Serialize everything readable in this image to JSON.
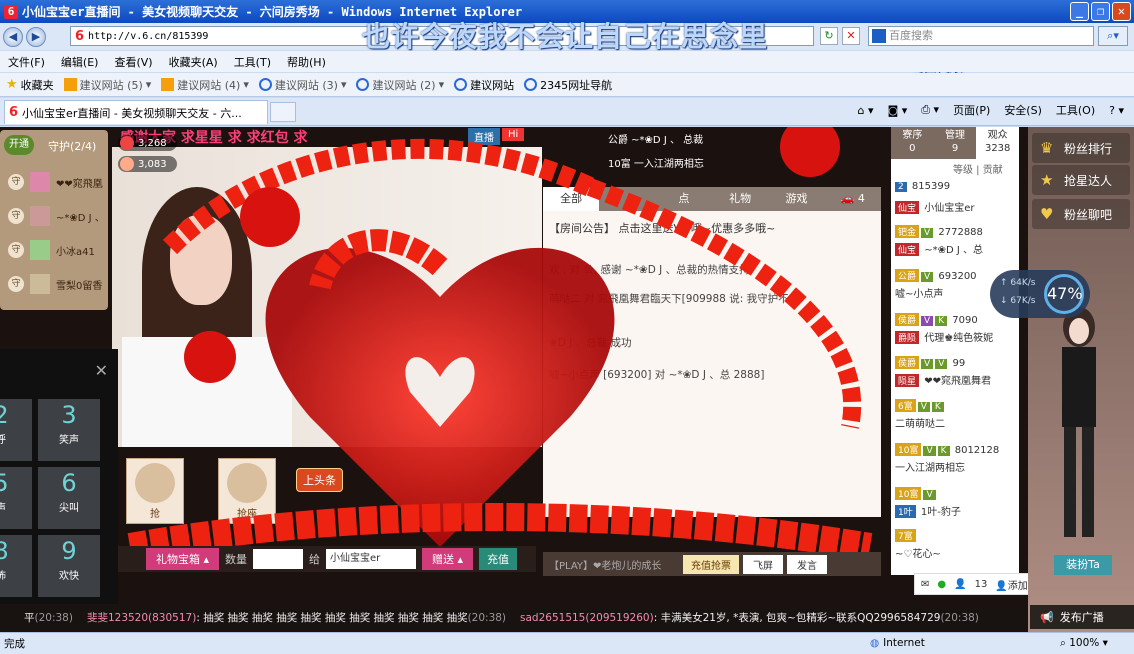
{
  "window": {
    "title": "小仙宝宝er直播间 - 美女视频聊天交友 - 六间房秀场 - Windows Internet Explorer",
    "url": "http://v.6.cn/815399",
    "search_placeholder": "百度搜索"
  },
  "overlay_lyrics": {
    "line1": "也许今夜我不会让自己在思念里",
    "line2": "沉沦"
  },
  "menu": [
    "文件(F)",
    "编辑(E)",
    "查看(V)",
    "收藏夹(A)",
    "工具(T)",
    "帮助(H)"
  ],
  "favorites": {
    "label": "收藏夹",
    "items": [
      "建议网站 (5)",
      "建议网站 (4)",
      "建议网站 (3)",
      "建议网站 (2)",
      "建议网站",
      "2345网址导航"
    ]
  },
  "tab": {
    "title": "小仙宝宝er直播间 - 美女视频聊天交友 - 六..."
  },
  "commands": [
    "页面(P)",
    "安全(S)",
    "工具(O)"
  ],
  "room": {
    "title_banner": "感谢大家 求星星 求 求红包 求",
    "live_label": "直播",
    "hi_label": "Hi",
    "counter1": "3,268",
    "counter2": "3,083",
    "top_fan1": "公爵  ~*❀D J 、 总裁",
    "top_fan2": "10富  一入江湖两相忘"
  },
  "guard": {
    "open_label": "开通",
    "title": "守护(2/4)",
    "members": [
      "❤❤窕飛凰",
      "~*❀D J 、",
      "小冰a41",
      "雪梨0留香"
    ]
  },
  "chat": {
    "tabs": [
      "全部",
      "",
      "点",
      "礼物",
      "游戏",
      ""
    ],
    "car_badge": "4",
    "announcement": "【房间公告】                    点击这里送VIP哦~优惠多多哦~",
    "lines": [
      "欢                , 对  公, 感谢 ~*❀D J 、总裁的热情支持!",
      "萌哒二 对         窕飛凰舞君臨天下[909988   说: 我守护不",
      "                ❀D J 、总裁 成功",
      "                  嘘~小点声 [693200] 对  ~*❀D J 、总    2888]"
    ]
  },
  "seats": {
    "seat1_label": "抢",
    "seat2_label": "抢座",
    "headline_label": "上头条"
  },
  "giftbar": {
    "gift_box": "礼物宝箱",
    "qty_label": "数量",
    "to_label": "给",
    "recipient": "小仙宝宝er",
    "send": "赠送",
    "recharge": "充值"
  },
  "inputbar": {
    "placeholder": "【PLAY】❤老炮儿的成长",
    "recharge_grab": "充值抢票",
    "fly_screen": "飞屏",
    "speak": "发言"
  },
  "side": {
    "tabs": [
      {
        "label": "寮序",
        "count": "0"
      },
      {
        "label": "管理",
        "count": "9"
      },
      {
        "label": "观众",
        "count": "3238"
      }
    ],
    "rank_labels": [
      "等级",
      "贡献"
    ],
    "users": [
      {
        "tags": [
          "2"
        ],
        "name": "815399"
      },
      {
        "tags": [
          "仙宝"
        ],
        "name": "小仙宝宝er"
      },
      {
        "tags": [
          "钯金",
          "V"
        ],
        "name": "2772888"
      },
      {
        "tags": [
          "仙宝"
        ],
        "name": "~*❀D J 、总"
      },
      {
        "tags": [
          "公爵",
          "V"
        ],
        "name": "693200"
      },
      {
        "tags": [],
        "name": "嘘~小点声"
      },
      {
        "tags": [
          "侯爵",
          "V",
          "K"
        ],
        "name": "7090"
      },
      {
        "tags": [
          "爵陨"
        ],
        "name": "代理♚纯色筱妮"
      },
      {
        "tags": [
          "侯爵",
          "V",
          "V"
        ],
        "name": "99"
      },
      {
        "tags": [
          "陨星"
        ],
        "name": "❤❤窕飛凰舞君"
      },
      {
        "tags": [
          "6富",
          "V",
          "K"
        ],
        "name": ""
      },
      {
        "tags": [],
        "name": "二萌萌哒二"
      },
      {
        "tags": [
          "10富",
          "V",
          "K"
        ],
        "name": "8012128"
      },
      {
        "tags": [],
        "name": "一入江湖两相忘"
      },
      {
        "tags": [
          "10富",
          "V"
        ],
        "name": ""
      },
      {
        "tags": [
          "1叶"
        ],
        "name": "1叶-豹子"
      },
      {
        "tags": [
          "7富"
        ],
        "name": ""
      },
      {
        "tags": [],
        "name": "~♡花心~"
      }
    ],
    "bottom_count": "13",
    "add_label": "添加"
  },
  "right_nav": {
    "items": [
      "粉丝排行",
      "抢星达人",
      "粉丝聊吧"
    ],
    "dress_label": "装扮Ta"
  },
  "net_widget": {
    "up": "64K/s",
    "down": "67K/s",
    "percent": "47%"
  },
  "keypad": {
    "keys": [
      {
        "n": "2",
        "t": "呼"
      },
      {
        "n": "3",
        "t": "笑声"
      },
      {
        "n": "5",
        "t": "声"
      },
      {
        "n": "6",
        "t": "尖叫"
      },
      {
        "n": "8",
        "t": "怖"
      },
      {
        "n": "9",
        "t": "欢快"
      }
    ]
  },
  "ticker": {
    "items": [
      {
        "name": "平",
        "time": "(20:38)",
        "text": ""
      },
      {
        "name": "斐斐123520(830517)",
        "text": ": 抽奖 抽奖 抽奖 抽奖 抽奖 抽奖 抽奖 抽奖 抽奖 抽奖 抽奖",
        "time": "(20:38)"
      },
      {
        "name": "sad2651515(209519260)",
        "text": ": 丰满美女21岁, *表演, 包爽~包精彩~联系QQ2996584729",
        "time": "(20:38)"
      }
    ],
    "broadcast": "发布广播"
  },
  "status": {
    "left": "完成",
    "zone": "Internet",
    "zoom": "100%"
  }
}
